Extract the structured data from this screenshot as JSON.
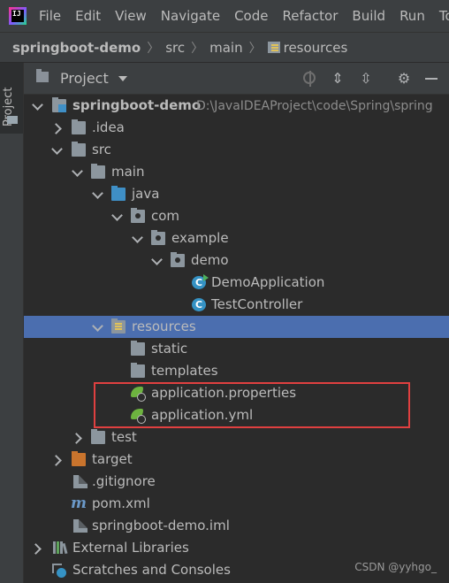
{
  "menu": {
    "logo_text": "IJ",
    "items": [
      "File",
      "Edit",
      "View",
      "Navigate",
      "Code",
      "Refactor",
      "Build",
      "Run",
      "To"
    ]
  },
  "breadcrumb": [
    "springboot-demo",
    "src",
    "main",
    "resources"
  ],
  "left_strip": {
    "tab_label": "Project"
  },
  "panel": {
    "title": "Project"
  },
  "tree": [
    {
      "label": "springboot-demo",
      "path": "D:\\JavaIDEAProject\\code\\Spring\\spring"
    },
    {
      "label": ".idea"
    },
    {
      "label": "src"
    },
    {
      "label": "main"
    },
    {
      "label": "java"
    },
    {
      "label": "com"
    },
    {
      "label": "example"
    },
    {
      "label": "demo"
    },
    {
      "label": "DemoApplication",
      "icon_letter": "C"
    },
    {
      "label": "TestController",
      "icon_letter": "C"
    },
    {
      "label": "resources"
    },
    {
      "label": "static"
    },
    {
      "label": "templates"
    },
    {
      "label": "application.properties"
    },
    {
      "label": "application.yml"
    },
    {
      "label": "test"
    },
    {
      "label": "target"
    },
    {
      "label": ".gitignore"
    },
    {
      "label": "pom.xml",
      "icon_letter": "m"
    },
    {
      "label": "springboot-demo.iml"
    },
    {
      "label": "External Libraries"
    },
    {
      "label": "Scratches and Consoles"
    }
  ],
  "colors": {
    "selection": "#4b6eaf",
    "highlight_box": "#e04040",
    "excluded_folder": "#c9742d"
  },
  "watermark": "CSDN @yyhgo_"
}
